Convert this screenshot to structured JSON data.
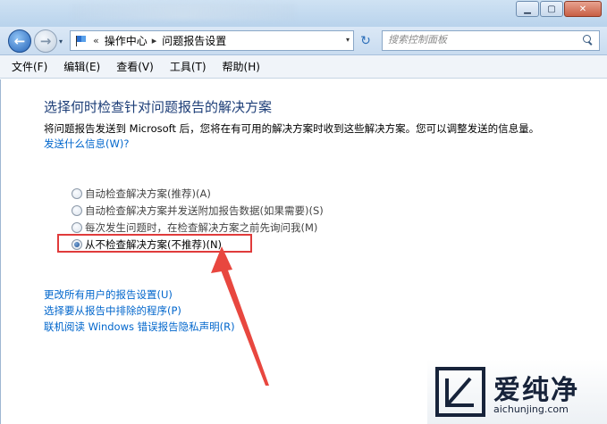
{
  "window": {
    "minimize_glyph": "▁",
    "maximize_glyph": "▢",
    "close_glyph": "✕"
  },
  "nav": {
    "back_glyph": "←",
    "forward_glyph": "→",
    "dropdown_glyph": "▾",
    "refresh_glyph": "↻"
  },
  "address": {
    "separator": "«",
    "crumb1": "操作中心",
    "arrow": "▸",
    "crumb2": "问题报告设置",
    "dropdown_glyph": "▾"
  },
  "search": {
    "placeholder": "搜索控制面板"
  },
  "menu": {
    "file": "文件(F)",
    "edit": "编辑(E)",
    "view": "查看(V)",
    "tools": "工具(T)",
    "help": "帮助(H)"
  },
  "content": {
    "heading": "选择何时检查针对问题报告的解决方案",
    "description": "将问题报告发送到 Microsoft 后，您将在有可用的解决方案时收到这些解决方案。您可以调整发送的信息量。",
    "info_link": "发送什么信息(W)?",
    "options": [
      {
        "label": "自动检查解决方案(推荐)(A)",
        "checked": false
      },
      {
        "label": "自动检查解决方案并发送附加报告数据(如果需要)(S)",
        "checked": false
      },
      {
        "label": "每次发生问题时，在检查解决方案之前先询问我(M)",
        "checked": false
      },
      {
        "label": "从不检查解决方案(不推荐)(N)",
        "checked": true
      }
    ],
    "links": [
      "更改所有用户的报告设置(U)",
      "选择要从报告中排除的程序(P)",
      "联机阅读 Windows 错误报告隐私声明(R)"
    ]
  },
  "annotation": {
    "highlight_color": "#e03b3b",
    "arrow_color": "#e8473f"
  },
  "watermark": {
    "brand": "爱纯净",
    "url": "aichunjing.com"
  }
}
